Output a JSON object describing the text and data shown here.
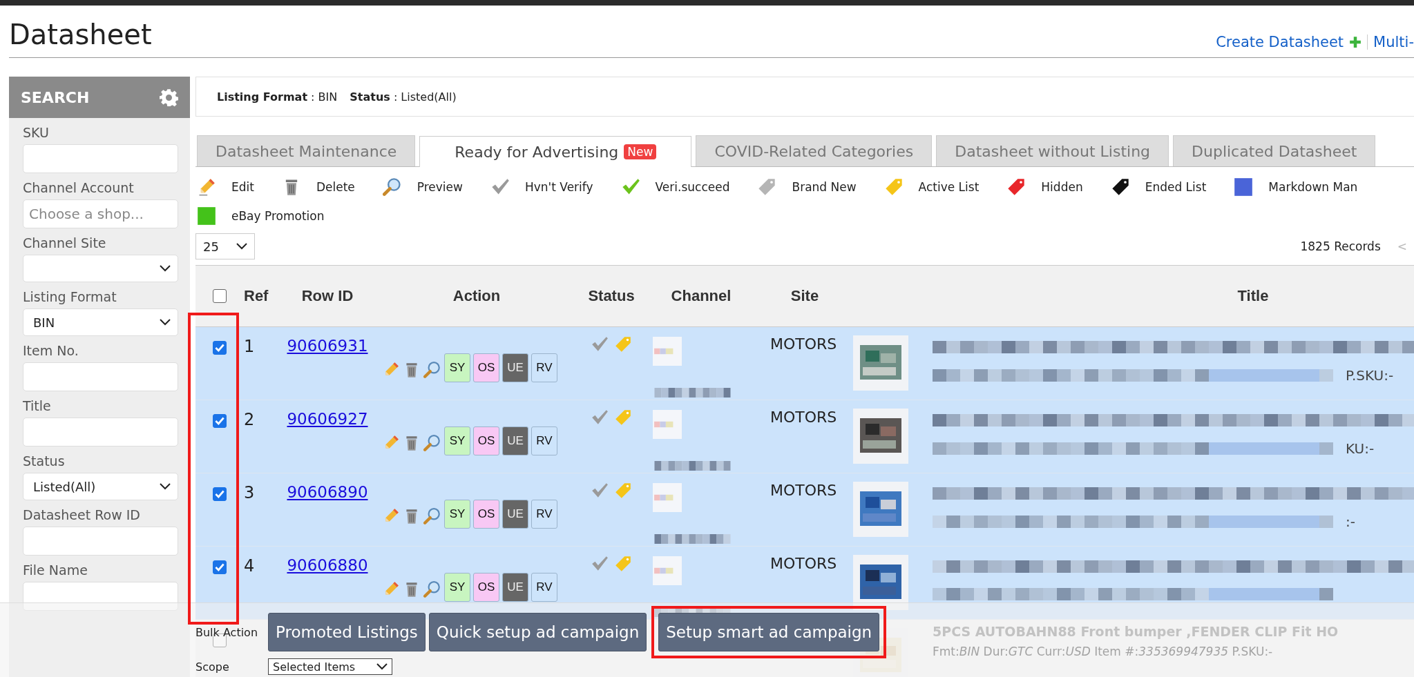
{
  "page_title": "Datasheet",
  "header_links": [
    {
      "label": "Create Datasheet",
      "kind": "plus"
    },
    {
      "label": "Multi-",
      "kind": "plain"
    }
  ],
  "search_panel": {
    "title": "SEARCH",
    "fields": [
      {
        "label": "SKU",
        "kind": "text"
      },
      {
        "label": "Channel Account",
        "kind": "text",
        "placeholder": "Choose a shop..."
      },
      {
        "label": "Channel Site",
        "kind": "select"
      },
      {
        "label": "Listing Format",
        "kind": "select",
        "value": "BIN"
      },
      {
        "label": "Item No.",
        "kind": "text"
      },
      {
        "label": "Title",
        "kind": "text"
      },
      {
        "label": "Status",
        "kind": "select",
        "value": "Listed(All)"
      },
      {
        "label": "Datasheet Row ID",
        "kind": "text"
      },
      {
        "label": "File Name",
        "kind": "text"
      }
    ]
  },
  "filter_summary": [
    {
      "label": "Listing Format",
      "value": ": BIN"
    },
    {
      "label": "Status",
      "value": ": Listed(All)"
    }
  ],
  "tabs": [
    {
      "label": "Datasheet Maintenance",
      "selected": false
    },
    {
      "label": "Ready for Advertising",
      "selected": true,
      "badge": "New"
    },
    {
      "label": "COVID-Related Categories",
      "selected": false
    },
    {
      "label": "Datasheet without Listing",
      "selected": false
    },
    {
      "label": "Duplicated Datasheet",
      "selected": false
    }
  ],
  "legend": [
    {
      "label": "Edit",
      "kind": "pencil"
    },
    {
      "label": "Delete",
      "kind": "trash"
    },
    {
      "label": "Preview",
      "kind": "magnifier"
    },
    {
      "label": "Hvn't Verify",
      "kind": "check",
      "color": "#9a9a9a"
    },
    {
      "label": "Veri.succeed",
      "kind": "check",
      "color": "#6cc31c"
    },
    {
      "label": "Brand New",
      "kind": "tag",
      "color": "#b5b5b5"
    },
    {
      "label": "Active List",
      "kind": "tag",
      "color": "#f5c518"
    },
    {
      "label": "Hidden",
      "kind": "tag",
      "color": "#e8262a"
    },
    {
      "label": "Ended List",
      "kind": "tag",
      "color": "#111111"
    },
    {
      "label": "Markdown Man",
      "kind": "square",
      "color": "#4a64d8"
    },
    {
      "label": "eBay Promotion",
      "kind": "square",
      "color": "#44c21a"
    }
  ],
  "page_size": "25",
  "record_count": "1825 Records",
  "pager_prev": "<",
  "table": {
    "columns": [
      "Ref",
      "Row ID",
      "Action",
      "Status",
      "Channel",
      "Site",
      "Title"
    ],
    "all_checked": false,
    "checkbox_column_highlighted": true,
    "rows": [
      {
        "checked": true,
        "ref": "1",
        "row_id": "90606931",
        "tags": [
          {
            "label": "SY",
            "color": "#c8f5c0"
          },
          {
            "label": "OS",
            "color": "#f8c8f4"
          },
          {
            "label": "UE",
            "color": "#666666"
          },
          {
            "label": "RV",
            "color": "#cde4fb"
          }
        ],
        "verified": false,
        "status_tag": {
          "color": "#f5c518"
        },
        "site": "MOTORS",
        "sku_tail": "P.SKU:-"
      },
      {
        "checked": true,
        "ref": "2",
        "row_id": "90606927",
        "tags": [
          {
            "label": "SY",
            "color": "#c8f5c0"
          },
          {
            "label": "OS",
            "color": "#f8c8f4"
          },
          {
            "label": "UE",
            "color": "#666666"
          },
          {
            "label": "RV",
            "color": "#cde4fb"
          }
        ],
        "verified": false,
        "status_tag": {
          "color": "#f5c518"
        },
        "site": "MOTORS",
        "sku_tail": "KU:-"
      },
      {
        "checked": true,
        "ref": "3",
        "row_id": "90606890",
        "tags": [
          {
            "label": "SY",
            "color": "#c8f5c0"
          },
          {
            "label": "OS",
            "color": "#f8c8f4"
          },
          {
            "label": "UE",
            "color": "#666666"
          },
          {
            "label": "RV",
            "color": "#cde4fb"
          }
        ],
        "verified": false,
        "status_tag": {
          "color": "#f5c518"
        },
        "site": "MOTORS",
        "sku_tail": ":-"
      },
      {
        "checked": true,
        "ref": "4",
        "row_id": "90606880",
        "tags": [
          {
            "label": "SY",
            "color": "#c8f5c0"
          },
          {
            "label": "OS",
            "color": "#f8c8f4"
          },
          {
            "label": "UE",
            "color": "#666666"
          },
          {
            "label": "RV",
            "color": "#cde4fb"
          }
        ],
        "verified": false,
        "status_tag": {
          "color": "#f5c518"
        },
        "site": "MOTORS"
      },
      {
        "checked": false,
        "title": "5PCS AUTOBAHN88 Front bumper ,FENDER CLIP Fit HO",
        "details": "Fmt:*BIN* Dur:*GTC* Curr:*USD* Item #:*335369947935* P.SKU:-"
      }
    ]
  },
  "bulk_bar": {
    "label": "Bulk Action",
    "buttons": [
      {
        "label": "Promoted Listings",
        "highlighted": false
      },
      {
        "label": "Quick setup ad campaign",
        "highlighted": false
      },
      {
        "label": "Setup smart ad campaign",
        "highlighted": true
      }
    ],
    "scope_label": "Scope",
    "scope_value": "Selected Items"
  }
}
